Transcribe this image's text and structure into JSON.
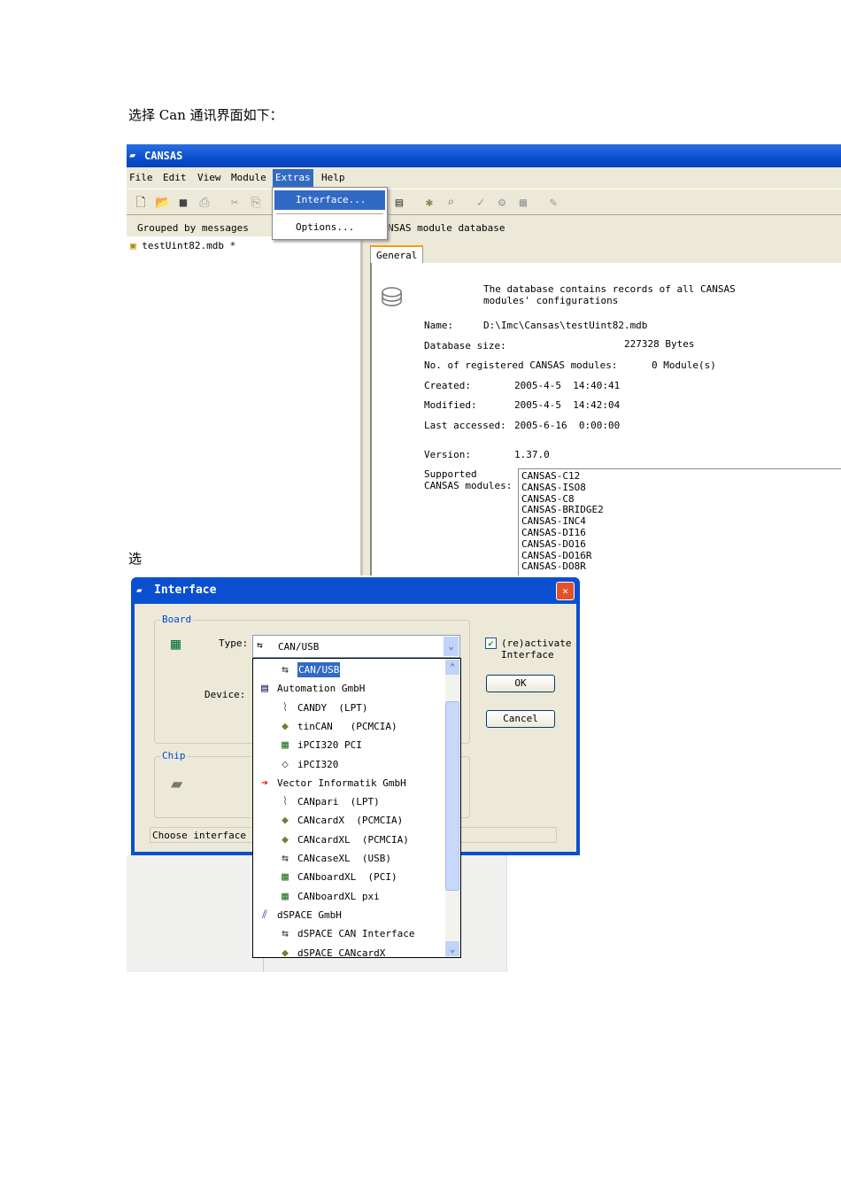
{
  "caption1": "选择 Can 通讯界面如下：",
  "caption2": "选",
  "app": {
    "title": "CANSAS",
    "menu": [
      "File",
      "Edit",
      "View",
      "Module",
      "Extras",
      "Help"
    ],
    "extras_menu": [
      "Interface...",
      "Options..."
    ],
    "left_header": "Grouped by messages",
    "tree_item": "testUint82.mdb *",
    "right_header": "NSAS module database",
    "tab": "General",
    "description": "The database contains records of all CANSAS modules' configurations",
    "fields": [
      {
        "label": "Name:",
        "value": "D:\\Imc\\Cansas\\testUint82.mdb"
      },
      {
        "label": "Database size:",
        "value": "227328 Bytes"
      },
      {
        "label": "No. of registered CANSAS modules:",
        "value": "0 Module(s)"
      },
      {
        "label": "Created:",
        "value": "2005-4-5  14:40:41"
      },
      {
        "label": "Modified:",
        "value": "2005-4-5  14:42:04"
      },
      {
        "label": "Last accessed:",
        "value": "2005-6-16  0:00:00"
      },
      {
        "label": "Version:",
        "value": "1.37.0"
      }
    ],
    "supported_label": "Supported CANSAS modules:",
    "supported_modules": [
      "CANSAS-C12",
      "CANSAS-ISO8",
      "CANSAS-C8",
      "CANSAS-BRIDGE2",
      "CANSAS-INC4",
      "CANSAS-DI16",
      "CANSAS-DO16",
      "CANSAS-DO16R",
      "CANSAS-DO8R"
    ]
  },
  "dialog": {
    "title": "Interface",
    "board_label": "Board",
    "type_label": "Type:",
    "type_value": "CAN/USB",
    "device_label": "Device:",
    "chip_label": "Chip",
    "reactivate_label": "(re)activate Interface",
    "reactivate_checked": true,
    "ok": "OK",
    "cancel": "Cancel",
    "status": "Choose interface a",
    "options": [
      {
        "label": "CAN/USB",
        "icon": "usb-icon",
        "level": 1,
        "selected": true
      },
      {
        "label": "Automation GmbH",
        "icon": "ixxat-logo-icon",
        "level": 0
      },
      {
        "label": "CANDY  (LPT)",
        "icon": "lpt-connector-icon",
        "level": 1
      },
      {
        "label": "tinCAN   (PCMCIA)",
        "icon": "pcmcia-card-icon",
        "level": 1
      },
      {
        "label": "iPCI320 PCI",
        "icon": "pci-board-icon",
        "level": 1
      },
      {
        "label": "iPCI320",
        "icon": "chip-diamond-icon",
        "level": 1
      },
      {
        "label": "Vector Informatik GmbH",
        "icon": "vector-arrow-icon",
        "level": 0
      },
      {
        "label": "CANpari  (LPT)",
        "icon": "lpt-connector-icon",
        "level": 1
      },
      {
        "label": "CANcardX  (PCMCIA)",
        "icon": "pcmcia-card-icon",
        "level": 1
      },
      {
        "label": "CANcardXL  (PCMCIA)",
        "icon": "pcmcia-card-icon",
        "level": 1
      },
      {
        "label": "CANcaseXL  (USB)",
        "icon": "usb-icon",
        "level": 1
      },
      {
        "label": "CANboardXL  (PCI)",
        "icon": "pci-board-icon",
        "level": 1
      },
      {
        "label": "CANboardXL pxi",
        "icon": "pci-board-icon",
        "level": 1
      },
      {
        "label": "dSPACE GmbH",
        "icon": "dspace-logo-icon",
        "level": 0
      },
      {
        "label": "dSPACE CAN Interface",
        "icon": "usb-icon",
        "level": 1
      },
      {
        "label": "dSPACE CANcardX",
        "icon": "pcmcia-card-icon",
        "level": 1
      }
    ]
  }
}
